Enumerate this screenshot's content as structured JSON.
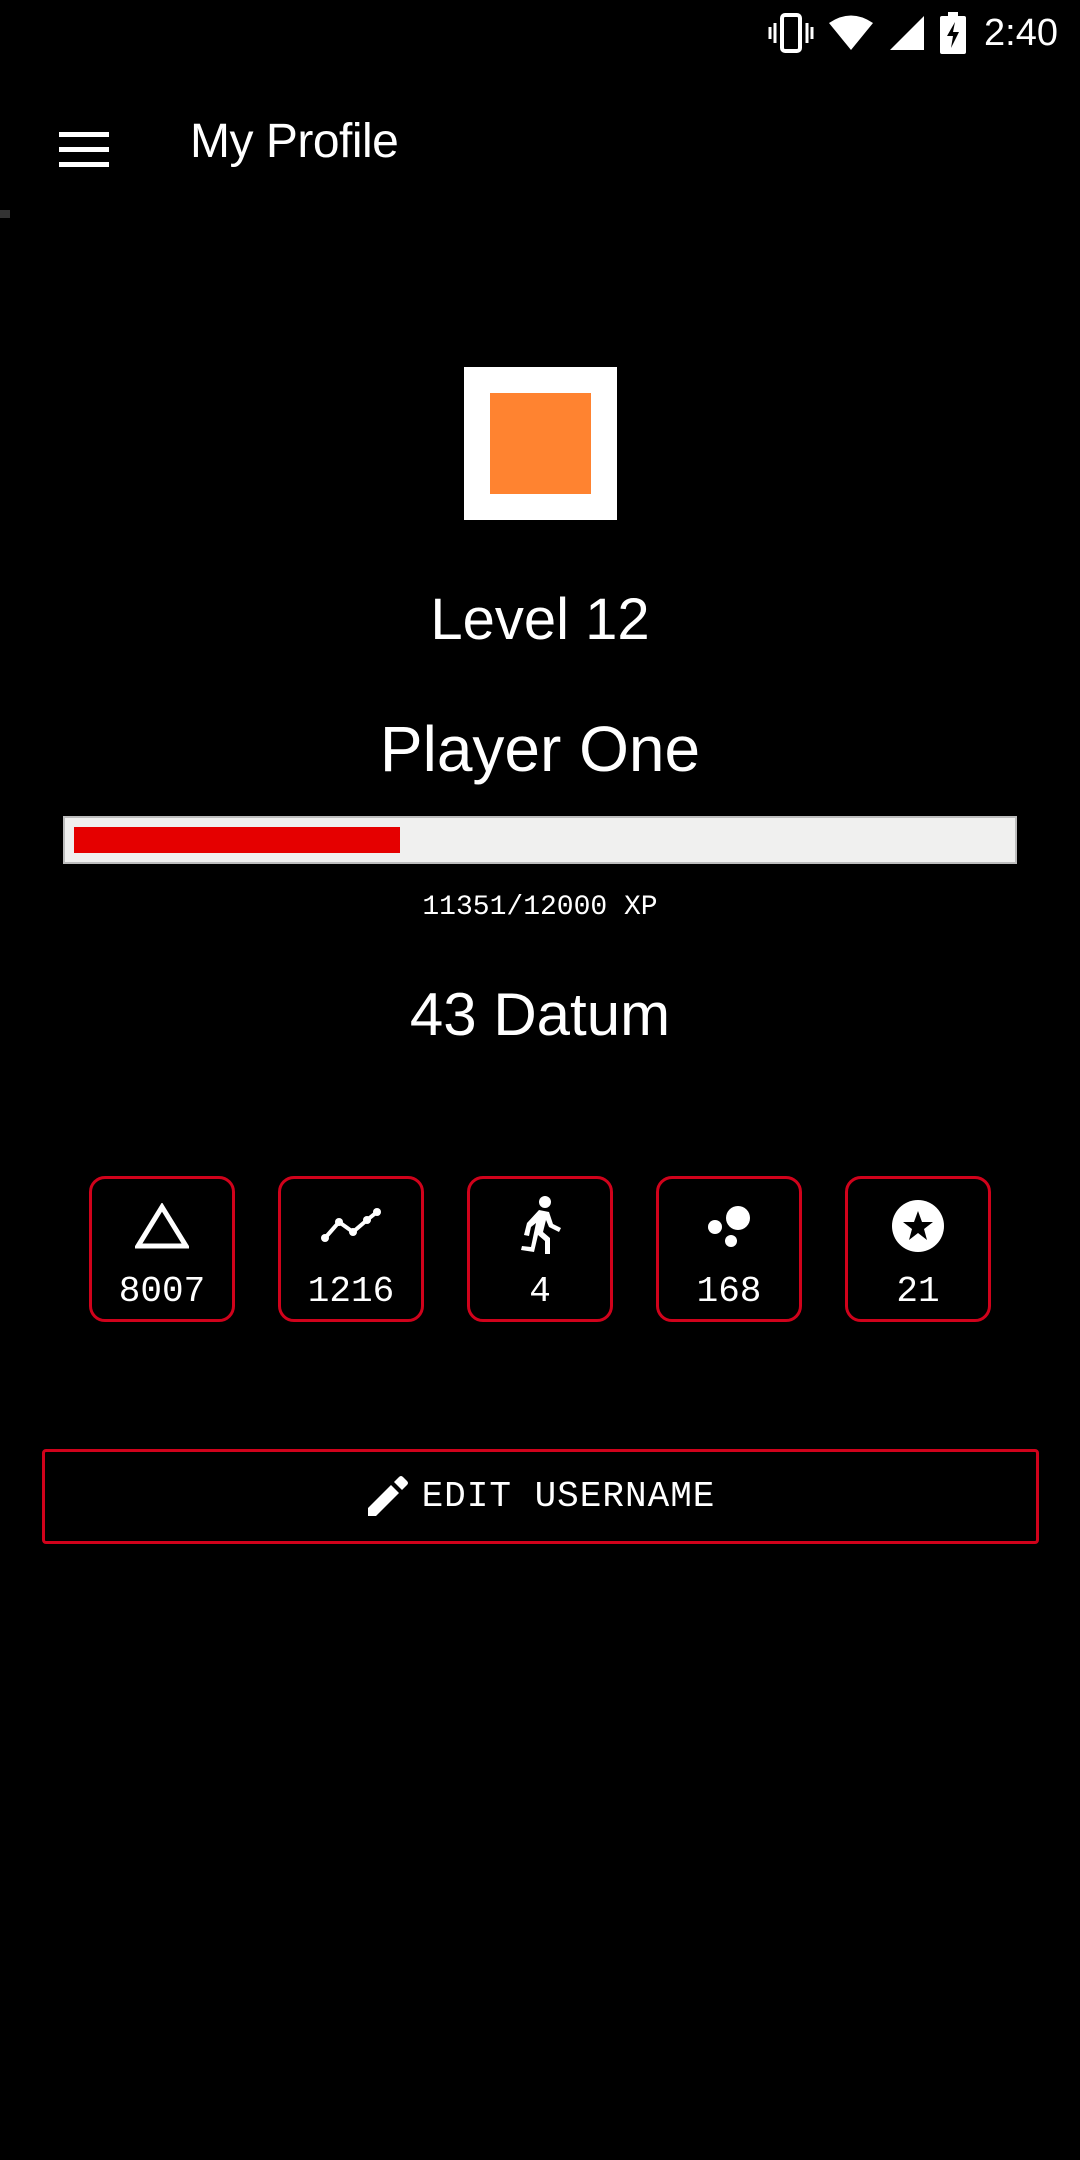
{
  "status_bar": {
    "time": "2:40",
    "icons": [
      "vibrate-icon",
      "wifi-icon",
      "signal-icon",
      "battery-charging-icon"
    ]
  },
  "toolbar": {
    "title": "My Profile",
    "menu_icon": "hamburger-menu-icon"
  },
  "profile": {
    "avatar_color": "#ff8330",
    "level": "Level 12",
    "player_name": "Player One",
    "xp_text": "11351/12000 XP",
    "xp_progress": 0.35,
    "datum": "43 Datum"
  },
  "stats": [
    {
      "icon": "triangle-outline-icon",
      "value": "8007"
    },
    {
      "icon": "trending-line-icon",
      "value": "1216"
    },
    {
      "icon": "running-person-icon",
      "value": "4"
    },
    {
      "icon": "bubbles-icon",
      "value": "168"
    },
    {
      "icon": "star-circle-icon",
      "value": "21"
    }
  ],
  "edit_button": {
    "label": "EDIT USERNAME",
    "icon": "pencil-icon"
  },
  "colors": {
    "accent": "#d0021b",
    "progress_fill": "#e50000",
    "progress_track": "#f0f0ef",
    "background": "#000000"
  }
}
